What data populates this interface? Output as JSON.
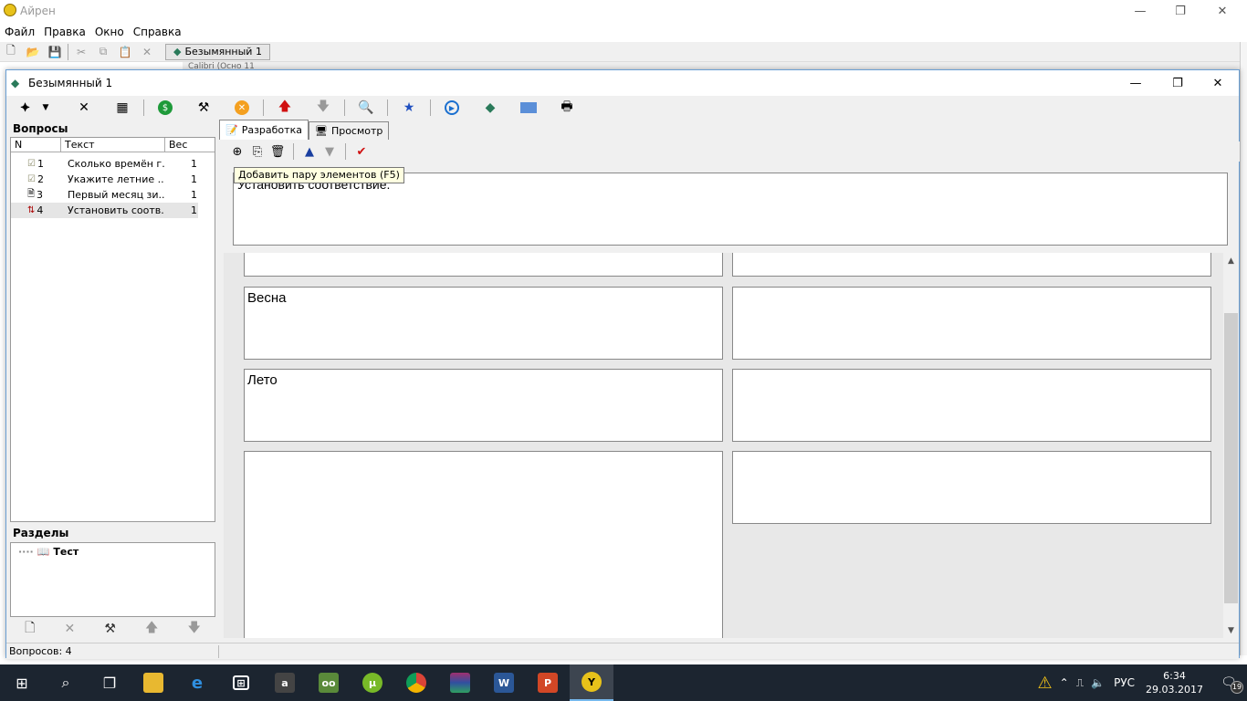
{
  "outer": {
    "title": "Айрен",
    "controls": {
      "minimize": "—",
      "maximize": "❐",
      "close": "✕"
    },
    "menu": [
      "Файл",
      "Правка",
      "Окно",
      "Справка"
    ],
    "doc_tab": "Безымянный 1",
    "ribbon_fragment": "Calibri (Осно   11"
  },
  "inner": {
    "title": "Безымянный 1",
    "controls": {
      "minimize": "—",
      "maximize": "❐",
      "close": "✕"
    }
  },
  "questions": {
    "header": "Вопросы",
    "columns": {
      "n": "N",
      "text": "Текст",
      "weight": "Вес"
    },
    "rows": [
      {
        "n": "1",
        "text": "Сколько времён г...",
        "weight": "1"
      },
      {
        "n": "2",
        "text": "Укажите летние ...",
        "weight": "1"
      },
      {
        "n": "3",
        "text": "Первый месяц зи...",
        "weight": "1"
      },
      {
        "n": "4",
        "text": "Установить соотв...",
        "weight": "1"
      }
    ]
  },
  "sections": {
    "header": "Разделы",
    "root": "Тест"
  },
  "status": {
    "text": "Вопросов: 4"
  },
  "tabs": [
    {
      "label": "Разработка",
      "active": true
    },
    {
      "label": "Просмотр",
      "active": false
    }
  ],
  "tooltip": "Добавить пару элементов (F5)",
  "question_text": "Установить соответствие.",
  "pairs": [
    {
      "left": "",
      "right": ""
    },
    {
      "left": "Весна",
      "right": ""
    },
    {
      "left": "Лето",
      "right": ""
    },
    {
      "left": "",
      "right": ""
    }
  ],
  "taskbar": {
    "lang": "РУС",
    "time": "6:34",
    "date": "29.03.2017",
    "notifications": "19"
  },
  "colors": {
    "accent": "#76b9ed",
    "taskbar": "#1c2530",
    "tooltip_bg": "#ffffe1"
  }
}
